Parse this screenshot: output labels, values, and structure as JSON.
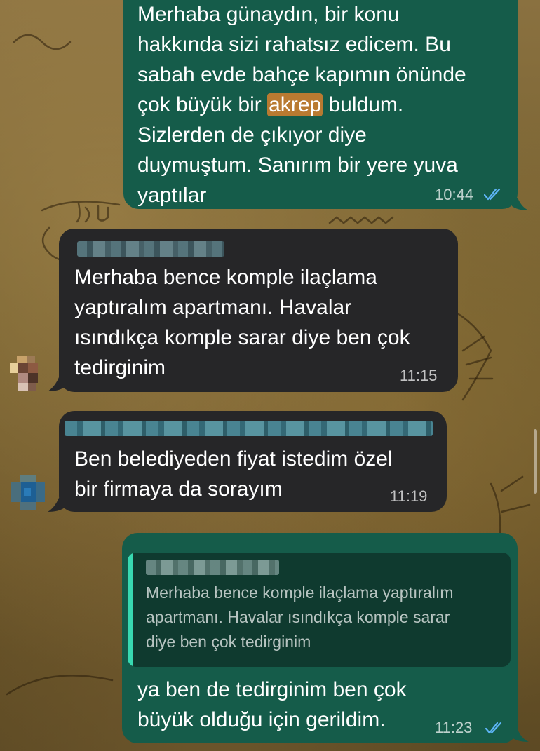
{
  "messages": [
    {
      "id": "m1",
      "direction": "outgoing",
      "text_before": "Merhaba günaydın, bir konu\nhakkında sizi rahatsız edicem. Bu\nsabah evde bahçe kapımın önünde\nçok büyük bir ",
      "highlight": "akrep",
      "text_after": " buldum.\nSizlerden de çıkıyor diye\nduymuştum. Sanırım bir yere yuva\nyaptılar",
      "time": "10:44",
      "status": "read"
    },
    {
      "id": "m2",
      "direction": "incoming",
      "sender_blurred": true,
      "text": "Merhaba bence komple ilaçlama\nyaptıralım apartmanı. Havalar\nısındıkça komple sarar diye ben çok\ntedirginim",
      "time": "11:15"
    },
    {
      "id": "m3",
      "direction": "incoming",
      "sender_blurred": true,
      "text": "Ben belediyeden fiyat istedim özel\nbir firmaya da sorayım",
      "time": "11:19"
    },
    {
      "id": "m4",
      "direction": "outgoing",
      "quoted_text": "Merhaba bence komple ilaçlama yaptıralım\napartmanı. Havalar ısındıkça komple sarar\ndiye ben çok tedirginim",
      "text": "ya ben de tedirginim ben çok\nbüyük olduğu için gerildim.",
      "time": "11:23",
      "status": "read"
    }
  ],
  "colors": {
    "outgoing_bubble": "#155c4a",
    "incoming_bubble": "#262628",
    "read_ticks": "#5eb5f7",
    "highlight": "#b97a31",
    "quote_bar": "#38d9b1"
  },
  "icons": [
    "double-check-icon",
    "avatar"
  ]
}
